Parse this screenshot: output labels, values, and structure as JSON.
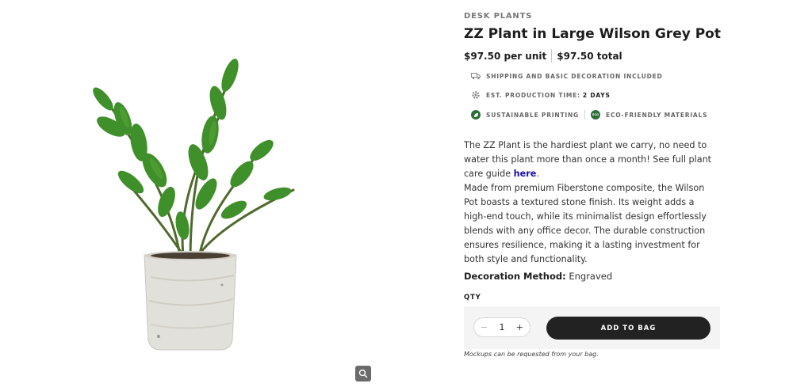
{
  "product": {
    "category": "DESK PLANTS",
    "title": "ZZ Plant in Large Wilson Grey Pot",
    "price_unit": "$97.50 per unit",
    "price_total": "$97.50 total"
  },
  "features": {
    "shipping": "SHIPPING AND BASIC DECORATION INCLUDED",
    "production_label": "EST. PRODUCTION TIME:",
    "production_value": "2 DAYS",
    "sustainable": "SUSTAINABLE PRINTING",
    "eco": "ECO-FRIENDLY MATERIALS",
    "eco_badge": "ECO"
  },
  "description": {
    "p1": "The ZZ Plant is the hardiest plant we carry, no need to water this plant more than once a month! See full plant care guide",
    "link": "here",
    "p1_end": ".",
    "p2": "Made from premium Fiberstone composite, the Wilson Pot boasts a textured stone finish. Its weight adds a high-end touch, while its minimalist design effortlessly blends with any office decor. The durable construction ensures resilience, making it a lasting investment for both style and functionality."
  },
  "decoration": {
    "label": "Decoration Method:",
    "value": "Engraved"
  },
  "purchase": {
    "qty_label": "QTY",
    "minus": "−",
    "quantity": "1",
    "plus": "+",
    "add_to_bag": "ADD TO BAG",
    "mockup_note": "Mockups can be requested from your bag."
  },
  "colors": {
    "accent_dark": "#222222",
    "eco_green": "#2e6e3a",
    "link_blue": "#1a0dab"
  },
  "icons": {
    "shipping": "truck-icon",
    "production": "gear-icon",
    "sustainable": "leaf-icon",
    "eco": "eco-badge-icon",
    "zoom": "magnifier-icon"
  }
}
